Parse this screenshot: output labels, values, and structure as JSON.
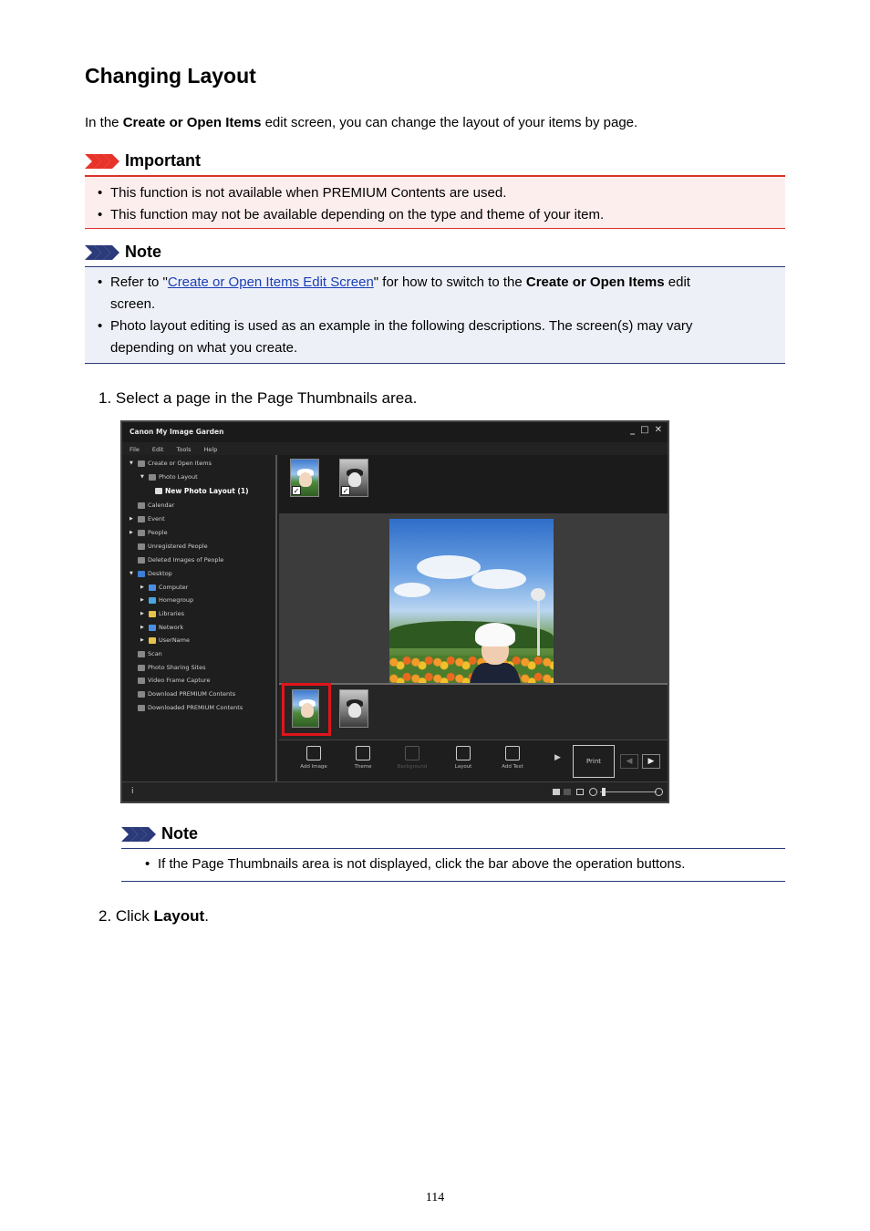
{
  "heading": "Changing Layout",
  "intro": {
    "before": "In the ",
    "bold": "Create or Open Items",
    "after": " edit screen, you can change the layout of your items by page."
  },
  "important": {
    "label": "Important",
    "color": "#d9342b",
    "items": [
      "This function is not available when PREMIUM Contents are used.",
      "This function may not be available depending on the type and theme of your item."
    ]
  },
  "note1": {
    "label": "Note",
    "color": "#2b3a7a",
    "item1": {
      "before": "Refer to \"",
      "link": "Create or Open Items Edit Screen",
      "middle": "\" for how to switch to the ",
      "bold": "Create or Open Items",
      "after": " edit",
      "line2": "screen."
    },
    "item2_line1": "Photo layout editing is used as an example in the following descriptions. The screen(s) may vary",
    "item2_line2": "depending on what you create."
  },
  "steps": {
    "step1": "1.  Select a page in the Page Thumbnails area.",
    "step2_before": "2.  Click ",
    "step2_bold": "Layout",
    "step2_after": "."
  },
  "app": {
    "window_title": "Canon My Image Garden",
    "window_buttons": [
      "_",
      "□",
      "✕"
    ],
    "menu": [
      "File",
      "Edit",
      "Tools",
      "Help"
    ],
    "tree": [
      {
        "label": "Create or Open Items",
        "twisty": "▼",
        "icon": "create-items-icon"
      },
      {
        "label": "Photo Layout",
        "twisty": "▼",
        "icon": "photo-layout-icon"
      },
      {
        "label": "New Photo Layout (1)",
        "twisty": "",
        "icon": "photo-layout-icon"
      },
      {
        "label": "Calendar",
        "twisty": "",
        "icon": "calendar-icon"
      },
      {
        "label": "Event",
        "twisty": "▶",
        "icon": "event-icon"
      },
      {
        "label": "People",
        "twisty": "▶",
        "icon": "people-icon"
      },
      {
        "label": "Unregistered People",
        "twisty": "",
        "icon": "unregistered-people-icon"
      },
      {
        "label": "Deleted Images of People",
        "twisty": "",
        "icon": "deleted-people-icon"
      },
      {
        "label": "Desktop",
        "twisty": "▼",
        "icon": "desktop-icon"
      },
      {
        "label": "Computer",
        "twisty": "▶",
        "icon": "computer-icon"
      },
      {
        "label": "Homegroup",
        "twisty": "▶",
        "icon": "homegroup-icon"
      },
      {
        "label": "Libraries",
        "twisty": "▶",
        "icon": "libraries-icon"
      },
      {
        "label": "Network",
        "twisty": "▶",
        "icon": "network-icon"
      },
      {
        "label": "UserName",
        "twisty": "▶",
        "icon": "user-folder-icon"
      },
      {
        "label": "Scan",
        "twisty": "",
        "icon": "scan-icon"
      },
      {
        "label": "Photo Sharing Sites",
        "twisty": "",
        "icon": "photo-sharing-icon"
      },
      {
        "label": "Video Frame Capture",
        "twisty": "",
        "icon": "video-frame-icon"
      },
      {
        "label": "Download PREMIUM Contents",
        "twisty": "",
        "icon": "download-icon"
      },
      {
        "label": "Downloaded PREMIUM Contents",
        "twisty": "",
        "icon": "downloaded-icon"
      }
    ],
    "ops": [
      "Add Image",
      "Theme",
      "Background",
      "Layout",
      "Add Text"
    ],
    "print_label": "Print",
    "status_info_icon": "i",
    "highlight_color": "#e0151b"
  },
  "note2": {
    "label": "Note",
    "item": "If the Page Thumbnails area is not displayed, click the bar above the operation buttons."
  },
  "page_number": "114"
}
